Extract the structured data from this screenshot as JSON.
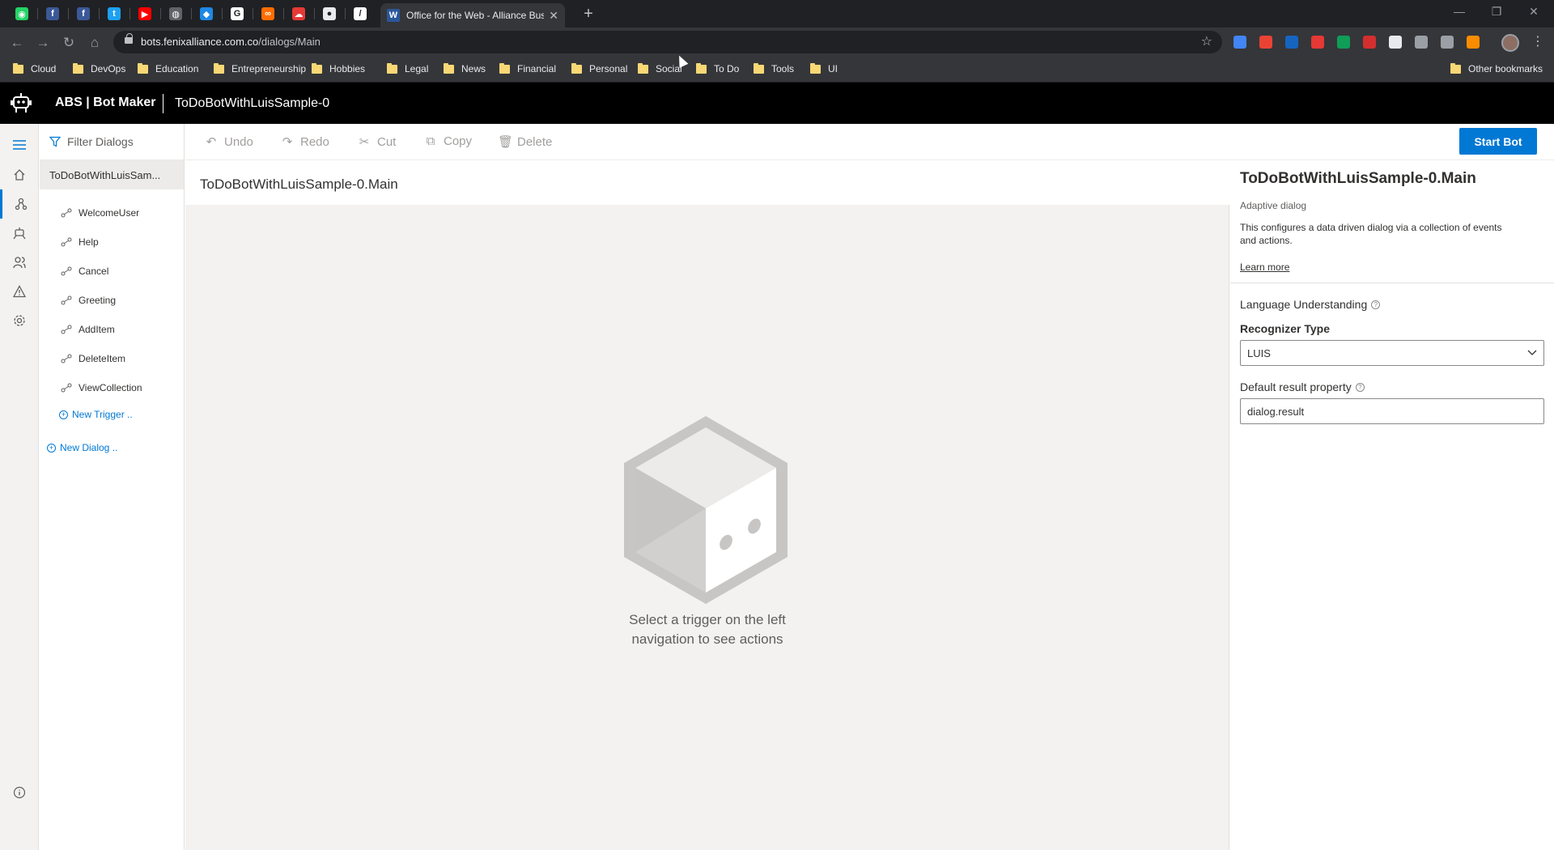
{
  "browser": {
    "pinned_tabs": [
      {
        "icon": "whatsapp-icon",
        "glyph": "◉",
        "color": "#25d366"
      },
      {
        "icon": "facebook-icon",
        "glyph": "f",
        "color": "#3b5998"
      },
      {
        "icon": "facebook-icon",
        "glyph": "f",
        "color": "#3b5998"
      },
      {
        "icon": "twitter-icon",
        "glyph": "t",
        "color": "#1da1f2"
      },
      {
        "icon": "youtube-icon",
        "glyph": "▶",
        "color": "#ff0000"
      },
      {
        "icon": "globe-icon",
        "glyph": "◍",
        "color": "#5f6368"
      },
      {
        "icon": "bot-icon",
        "glyph": "◆",
        "color": "#1e88e5"
      },
      {
        "icon": "google-icon",
        "glyph": "G",
        "color": "#ffffff"
      },
      {
        "icon": "link-icon",
        "glyph": "∞",
        "color": "#ff6d00"
      },
      {
        "icon": "cloud-icon",
        "glyph": "☁",
        "color": "#e53935"
      },
      {
        "icon": "github-icon",
        "glyph": "●",
        "color": "#e8eaed"
      },
      {
        "icon": "edit-icon",
        "glyph": "/",
        "color": "#ffffff"
      }
    ],
    "active_tab": {
      "favicon": "W",
      "title": "Office for the Web - Alliance Bus",
      "close": "✕"
    },
    "new_tab": "+",
    "window_controls": {
      "minimize": "—",
      "restore": "❐",
      "close": "✕"
    },
    "nav": {
      "back": "←",
      "forward": "→",
      "reload": "↻",
      "home": "⌂"
    },
    "url": {
      "host": "bots.fenixalliance.com.co",
      "path": "/dialogs/Main"
    },
    "star": "☆",
    "extensions_colors": [
      "#4285f4",
      "#ea4335",
      "#1565c0",
      "#e53935",
      "#0f9d58",
      "#d32f2f",
      "#e8eaed",
      "#9aa0a6",
      "#9aa0a6",
      "#fb8c00"
    ],
    "menu": "⋮",
    "bookmarks": [
      "Cloud",
      "DevOps",
      "Education",
      "Entrepreneurship",
      "Hobbies",
      "Legal",
      "News",
      "Financial",
      "Personal",
      "Social",
      "To Do",
      "Tools",
      "UI"
    ],
    "other_bookmarks": "Other bookmarks"
  },
  "app": {
    "brand": "ABS | Bot Maker",
    "bot_name": "ToDoBotWithLuisSample-0"
  },
  "rail": {
    "icons": [
      "menu-icon",
      "home-icon",
      "dialogs-icon",
      "bot-responses-icon",
      "users-icon",
      "notifications-icon",
      "settings-icon"
    ],
    "info_icon": "info-icon"
  },
  "tree": {
    "filter_placeholder": "Filter Dialogs",
    "main_dialog": "ToDoBotWithLuisSam...",
    "triggers": [
      "WelcomeUser",
      "Help",
      "Cancel",
      "Greeting",
      "AddItem",
      "DeleteItem",
      "ViewCollection"
    ],
    "new_trigger": "New Trigger ..",
    "new_dialog": "New Dialog .."
  },
  "toolbar": {
    "undo": "Undo",
    "redo": "Redo",
    "cut": "Cut",
    "copy": "Copy",
    "delete": "Delete",
    "start_bot": "Start Bot"
  },
  "canvas": {
    "title": "ToDoBotWithLuisSample-0.Main",
    "empty_line1": "Select a trigger on the left",
    "empty_line2": "navigation to see actions"
  },
  "properties": {
    "title": "ToDoBotWithLuisSample-0.Main",
    "subtitle": "Adaptive dialog",
    "description": "This configures a data driven dialog via a collection of events and actions.",
    "learn_more": "Learn more",
    "section": "Language Understanding",
    "recognizer_label": "Recognizer Type",
    "recognizer_value": "LUIS",
    "default_result_label": "Default result property",
    "default_result_value": "dialog.result"
  }
}
